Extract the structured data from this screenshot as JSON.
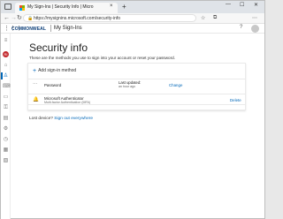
{
  "browser": {
    "tab_title": "My Sign-Ins | Security Info | Micro",
    "tab_close": "×",
    "new_tab": "+",
    "window_controls": [
      "—",
      "☐",
      "✕"
    ],
    "nav": {
      "back": "←",
      "forward": "→",
      "refresh": "↻"
    },
    "url": "https://mysignins.microsoft.com/security-info",
    "lock_icon": "🔒",
    "toolbar_icons": [
      "☆",
      "⧉",
      "⋯"
    ]
  },
  "app_header": {
    "waffle": "⋮⋮⋮",
    "brand": "COMMONWEAL",
    "app_name": "My Sign-Ins",
    "help": "?"
  },
  "rail": {
    "avatar_initials": "RI",
    "icons": [
      "overview-icon",
      "security-info-icon",
      "devices-icon",
      "password-icon",
      "organizations-icon",
      "settings-icon",
      "recent-activity-icon",
      "apps-icon",
      "subscriptions-icon"
    ],
    "glyphs": [
      "⌂",
      "♙",
      "⌨",
      "▭",
      "⚿",
      "▤",
      "⚙",
      "◷",
      "▦",
      "▧"
    ]
  },
  "page": {
    "title": "Security info",
    "description": "These are the methods you use to sign into your account or reset your password.",
    "add_method": "Add sign-in method",
    "add_plus": "+",
    "methods": [
      {
        "icon": "⋯",
        "name": "Password",
        "sub": "",
        "mid1": "Last updated:",
        "mid2": "an hour ago",
        "action": "Change"
      },
      {
        "icon": "🔔",
        "name": "Microsoft Authenticator",
        "sub": "Multi-factor Authentication (MFA)",
        "mid1": "",
        "mid2": "",
        "action": "Delete"
      }
    ],
    "lost_text": "Lost device?",
    "lost_link": "Sign out everywhere"
  },
  "colors": {
    "accent": "#0067b8",
    "brand": "#0a3d78",
    "avatar": "#c2282c",
    "favicon": [
      "#f25022",
      "#7fba00",
      "#00a4ef",
      "#ffb900"
    ]
  }
}
